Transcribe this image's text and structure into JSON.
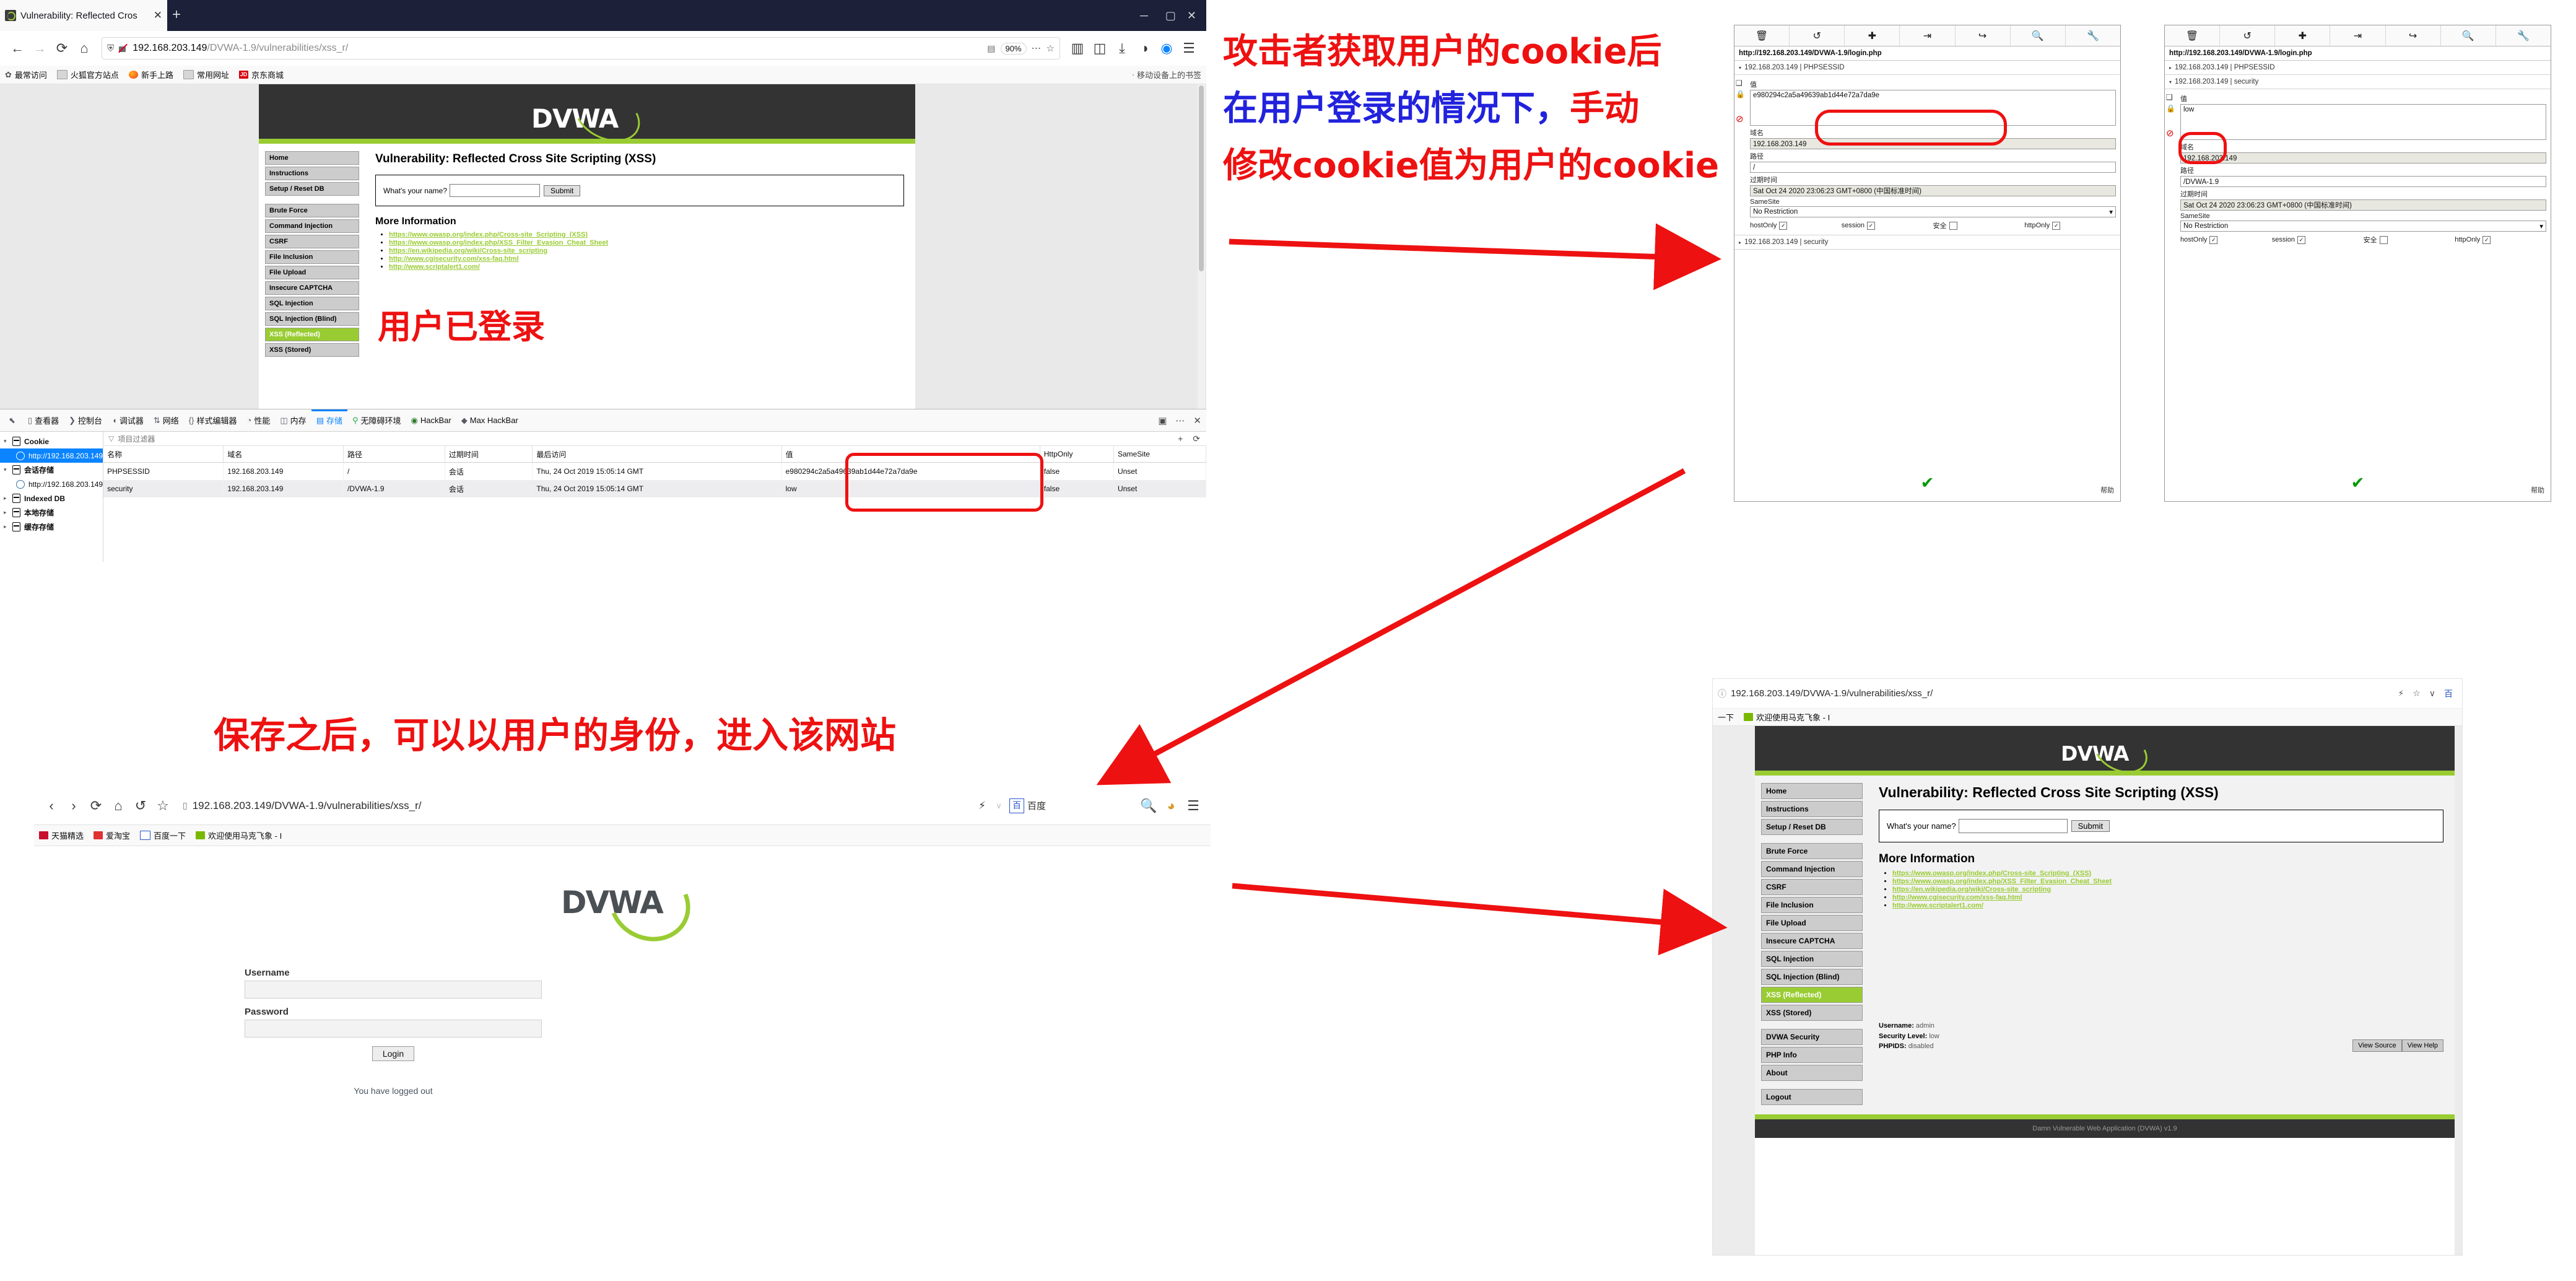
{
  "annotations": {
    "line1": "攻击者获取用户的cookie后",
    "line2": "在用户登录的情况下，",
    "line2b": "手动",
    "line3": "修改cookie值为用户的cookie",
    "logged_in": "用户已登录",
    "saved_note": "保存之后，可以以用户的身份，进入该网站",
    "accent_red": "#ee1111",
    "accent_blue": "#2222dd"
  },
  "browser_top": {
    "tab_title": "Vulnerability: Reflected Cros",
    "tab_close": "✕",
    "new_tab": "+",
    "url_plain": "192.168.203.149",
    "url_dim": "/DVWA-1.9/vulnerabilities/xss_r/",
    "zoom": "90%",
    "bookmarks": [
      {
        "label": "最常访问",
        "icon": "gear-icon"
      },
      {
        "label": "火狐官方站点",
        "icon": "folder-icon"
      },
      {
        "label": "新手上路",
        "icon": "firefox-icon"
      },
      {
        "label": "常用网址",
        "icon": "folder-icon"
      },
      {
        "label": "京东商城",
        "icon": "jd-icon"
      }
    ],
    "bookmarks_right": "移动设备上的书签"
  },
  "dvwa": {
    "logo_text": "DVWA",
    "title": "Vulnerability: Reflected Cross Site Scripting (XSS)",
    "form_label": "What's your name?",
    "form_value": "",
    "submit_label": "Submit",
    "more_info_title": "More Information",
    "links": [
      "https://www.owasp.org/index.php/Cross-site_Scripting_(XSS)",
      "https://www.owasp.org/index.php/XSS_Filter_Evasion_Cheat_Sheet",
      "https://en.wikipedia.org/wiki/Cross-site_scripting",
      "http://www.cgisecurity.com/xss-faq.html",
      "http://www.scriptalert1.com/"
    ],
    "nav_group1": [
      "Home",
      "Instructions",
      "Setup / Reset DB"
    ],
    "nav_group2": [
      "Brute Force",
      "Command Injection",
      "CSRF",
      "File Inclusion",
      "File Upload",
      "Insecure CAPTCHA",
      "SQL Injection",
      "SQL Injection (Blind)",
      "XSS (Reflected)",
      "XSS (Stored)"
    ],
    "nav_group3": [
      "DVWA Security",
      "PHP Info",
      "About"
    ],
    "nav_group4": [
      "Logout"
    ],
    "active_nav": "XSS (Reflected)",
    "userinfo": {
      "username_label": "Username:",
      "username_value": "admin",
      "security_label": "Security Level:",
      "security_value": "low",
      "phpids_label": "PHPIDS:",
      "phpids_value": "disabled"
    },
    "view_source": "View Source",
    "view_help": "View Help",
    "footer": "Damn Vulnerable Web Application (DVWA) v1.9"
  },
  "devtools": {
    "tabs": [
      {
        "label": "",
        "glyph": "⬉",
        "active": false
      },
      {
        "label": "查看器",
        "glyph": "▯",
        "active": false
      },
      {
        "label": "控制台",
        "glyph": "⟫",
        "active": false
      },
      {
        "label": "调试器",
        "glyph": "◗",
        "active": false
      },
      {
        "label": "网络",
        "glyph": "↑↓",
        "active": false
      },
      {
        "label": "样式编辑器",
        "glyph": "{}",
        "active": false
      },
      {
        "label": "性能",
        "glyph": "◔",
        "active": false
      },
      {
        "label": "内存",
        "glyph": "◫",
        "active": false
      },
      {
        "label": "存储",
        "glyph": "▤",
        "active": true
      },
      {
        "label": "无障碍环境",
        "glyph": "人",
        "active": false
      },
      {
        "label": "HackBar",
        "glyph": "◉",
        "active": false
      },
      {
        "label": "Max HackBar",
        "glyph": "◆",
        "active": false
      }
    ],
    "tree": [
      {
        "label": "Cookie",
        "type": "db",
        "expanded": true,
        "bold": true,
        "indent": 0
      },
      {
        "label": "http://192.168.203.149",
        "type": "globe",
        "selected": true,
        "indent": 1
      },
      {
        "label": "会话存储",
        "type": "db",
        "expanded": true,
        "bold": true,
        "indent": 0
      },
      {
        "label": "http://192.168.203.149",
        "type": "globe",
        "indent": 1
      },
      {
        "label": "Indexed DB",
        "type": "db",
        "expanded": false,
        "bold": true,
        "indent": 0
      },
      {
        "label": "本地存储",
        "type": "db",
        "expanded": false,
        "bold": true,
        "indent": 0
      },
      {
        "label": "缓存存储",
        "type": "db",
        "expanded": false,
        "bold": true,
        "indent": 0
      }
    ],
    "filter_placeholder": "项目过滤器",
    "columns": [
      "名称",
      "域名",
      "路径",
      "过期时间",
      "最后访问",
      "值",
      "HttpOnly",
      "SameSite"
    ],
    "rows": [
      [
        "PHPSESSID",
        "192.168.203.149",
        "/",
        "会话",
        "Thu, 24 Oct 2019 15:05:14 GMT",
        "e980294c2a5a49639ab1d44e72a7da9e",
        "false",
        "Unset"
      ],
      [
        "security",
        "192.168.203.149",
        "/DVWA-1.9",
        "会话",
        "Thu, 24 Oct 2019 15:05:14 GMT",
        "low",
        "false",
        "Unset"
      ]
    ]
  },
  "cookie_manager_1": {
    "toolbar_icons": [
      "trash-icon",
      "reload-icon",
      "plus-icon",
      "import-icon",
      "export-icon",
      "search-icon",
      "wrench-icon"
    ],
    "url": "http://192.168.203.149/DVWA-1.9/login.php",
    "group_collapsed": "192.168.203.149 | PHPSESSID",
    "group_expanded_label": "192.168.203.149 | PHPSESSID",
    "value_label": "值",
    "value": "e980294c2a5a49639ab1d44e72a7da9e",
    "domain_label": "域名",
    "domain": "192.168.203.149",
    "path_label": "路径",
    "path": "/",
    "expiry_label": "过期时间",
    "expiry": "Sat Oct 24 2020 23:06:23 GMT+0800 (中国标准时间)",
    "samesite_label": "SameSite",
    "samesite": "No Restriction",
    "checks": [
      {
        "label": "hostOnly",
        "checked": true
      },
      {
        "label": "session",
        "checked": true
      },
      {
        "label": "安全",
        "checked": false
      },
      {
        "label": "httpOnly",
        "checked": true
      }
    ],
    "footer_group": "192.168.203.149 | security",
    "ok_mark": "✔",
    "help_label": "帮助"
  },
  "cookie_manager_2": {
    "url": "http://192.168.203.149/DVWA-1.9/login.php",
    "group1": "192.168.203.149 | PHPSESSID",
    "group2": "192.168.203.149 | security",
    "value_label": "值",
    "value": "low",
    "domain_label": "域名",
    "domain": "192.168.203.149",
    "path_label": "路径",
    "path": "/DVWA-1.9",
    "expiry_label": "过期时间",
    "expiry": "Sat Oct 24 2020 23:06:23 GMT+0800 (中国标准时间)",
    "samesite_label": "SameSite",
    "samesite": "No Restriction",
    "checks": [
      {
        "label": "hostOnly",
        "checked": true
      },
      {
        "label": "session",
        "checked": true
      },
      {
        "label": "安全",
        "checked": false
      },
      {
        "label": "httpOnly",
        "checked": true
      }
    ],
    "ok_mark": "✔",
    "help_label": "帮助"
  },
  "browser_bottom_left": {
    "url": "192.168.203.149/DVWA-1.9/vulnerabilities/xss_r/",
    "search_engine": "百度",
    "bookmarks": [
      {
        "label": "天猫精选",
        "color": "#c8102e"
      },
      {
        "label": "爱淘宝",
        "color": "#e03131"
      },
      {
        "label": "百度一下",
        "color": "#2b55cc"
      },
      {
        "label": "欢迎使用马克飞象 - I",
        "color": "#7ab800"
      }
    ],
    "login_page": {
      "username_label": "Username",
      "password_label": "Password",
      "login_button": "Login",
      "status": "You have logged out",
      "username_value": "",
      "password_value": ""
    }
  },
  "browser_bottom_right": {
    "url": "192.168.203.149/DVWA-1.9/vulnerabilities/xss_r/",
    "bookmark_left": "一下",
    "bookmarks": [
      {
        "label": "欢迎使用马克飞象 - I",
        "color": "#7ab800"
      }
    ]
  }
}
